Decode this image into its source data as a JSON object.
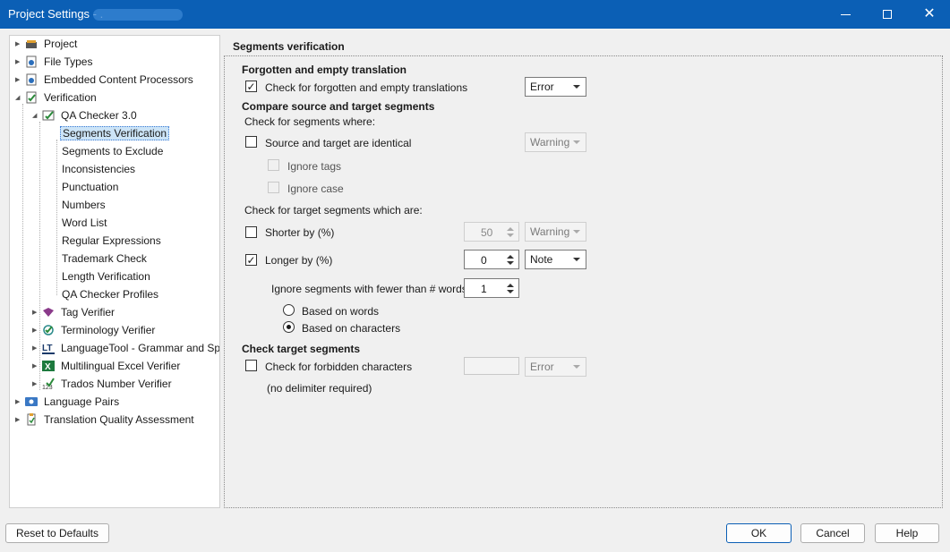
{
  "window": {
    "title": "Project Settings - ."
  },
  "tree": {
    "project": "Project",
    "file_types": "File Types",
    "embedded": "Embedded Content Processors",
    "verification": "Verification",
    "qa_checker": "QA Checker 3.0",
    "segments_verification": "Segments Verification",
    "segments_to_exclude": "Segments to Exclude",
    "inconsistencies": "Inconsistencies",
    "punctuation": "Punctuation",
    "numbers": "Numbers",
    "word_list": "Word List",
    "regular_expressions": "Regular Expressions",
    "trademark_check": "Trademark Check",
    "length_verification": "Length Verification",
    "qa_checker_profiles": "QA Checker Profiles",
    "tag_verifier": "Tag Verifier",
    "terminology_verifier": "Terminology Verifier",
    "languagetool": "LanguageTool - Grammar and Spe",
    "multilingual_excel": "Multilingual Excel Verifier",
    "trados_number": "Trados Number Verifier",
    "language_pairs": "Language Pairs",
    "tqa": "Translation Quality Assessment"
  },
  "panel": {
    "title": "Segments verification",
    "forgotten_heading": "Forgotten and empty translation",
    "forgotten_check": "Check for forgotten and empty translations",
    "forgotten_check_checked": true,
    "forgotten_severity": "Error",
    "compare_heading": "Compare source and target segments",
    "check_where": "Check for segments where:",
    "identical": "Source and target are identical",
    "identical_checked": false,
    "identical_severity": "Warning",
    "ignore_tags": "Ignore tags",
    "ignore_case": "Ignore case",
    "target_which": "Check for target segments which are:",
    "shorter": "Shorter by (%)",
    "shorter_checked": false,
    "shorter_value": "50",
    "shorter_severity": "Warning",
    "longer": "Longer by (%)",
    "longer_checked": true,
    "longer_value": "0",
    "longer_severity": "Note",
    "ignore_fewer": "Ignore segments with fewer than # words:",
    "ignore_fewer_value": "1",
    "based_words": "Based on words",
    "based_chars": "Based on characters",
    "based_selected": "characters",
    "check_target_heading": "Check target segments",
    "forbidden": "Check for forbidden characters",
    "forbidden_checked": false,
    "forbidden_severity": "Error",
    "no_delimiter": "(no delimiter required)"
  },
  "footer": {
    "reset": "Reset to Defaults",
    "ok": "OK",
    "cancel": "Cancel",
    "help": "Help"
  },
  "colors": {
    "titlebar": "#0b5fb5",
    "selection": "#cce4f7"
  }
}
